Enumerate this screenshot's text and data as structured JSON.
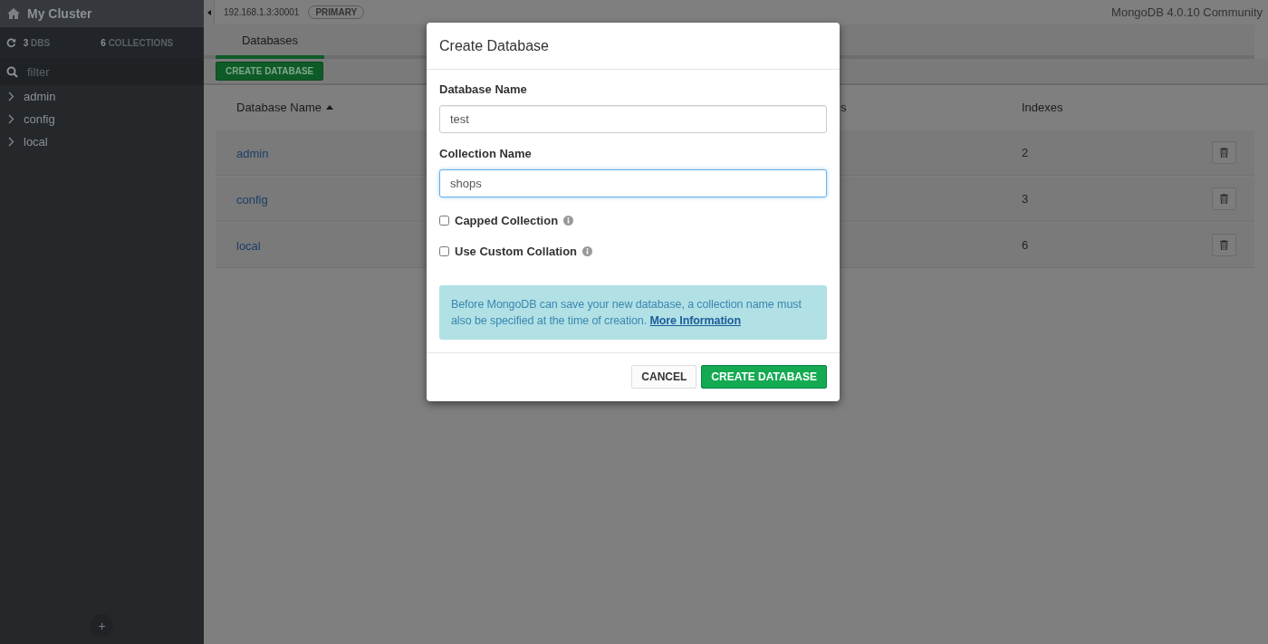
{
  "sidebar": {
    "title": "My Cluster",
    "stats": [
      {
        "count": "3",
        "label": "DBS"
      },
      {
        "count": "6",
        "label": "COLLECTIONS"
      }
    ],
    "filter": {
      "placeholder": "filter"
    },
    "items": [
      {
        "label": "admin",
        "expanded": false
      },
      {
        "label": "config",
        "expanded": false
      },
      {
        "label": "local",
        "expanded": false
      }
    ],
    "add_button": "+"
  },
  "topbar": {
    "host": "192.168.1.3:30001",
    "badge": "PRIMARY",
    "version": "MongoDB 4.0.10 Community"
  },
  "tabs": [
    {
      "label": "Databases",
      "selected": true
    }
  ],
  "toolbar": {
    "button": "CREATE DATABASE"
  },
  "table": {
    "columns": [
      {
        "label": "Database Name",
        "sorted_ascending": true
      },
      {
        "label": "s"
      },
      {
        "label": "Indexes"
      }
    ],
    "rows": [
      {
        "name": "admin",
        "indexes": "2"
      },
      {
        "name": "config",
        "indexes": "3"
      },
      {
        "name": "local",
        "indexes": "6"
      }
    ]
  },
  "dialog": {
    "title": "Create Database",
    "fields": [
      {
        "label": "Database Name",
        "value": "test",
        "focused": false
      },
      {
        "label": "Collection Name",
        "value": "shops",
        "focused": true
      }
    ],
    "options": [
      {
        "label": "Capped Collection",
        "checked": false
      },
      {
        "label": "Use Custom Collation",
        "checked": false
      }
    ],
    "notice": "Before MongoDB can save your new database, a collection name must also be specified at the time of creation.",
    "notice_link": "More Information",
    "buttons": [
      {
        "label": "CANCEL",
        "kind": "secondary"
      },
      {
        "label": "CREATE DATABASE",
        "kind": "primary"
      }
    ]
  }
}
